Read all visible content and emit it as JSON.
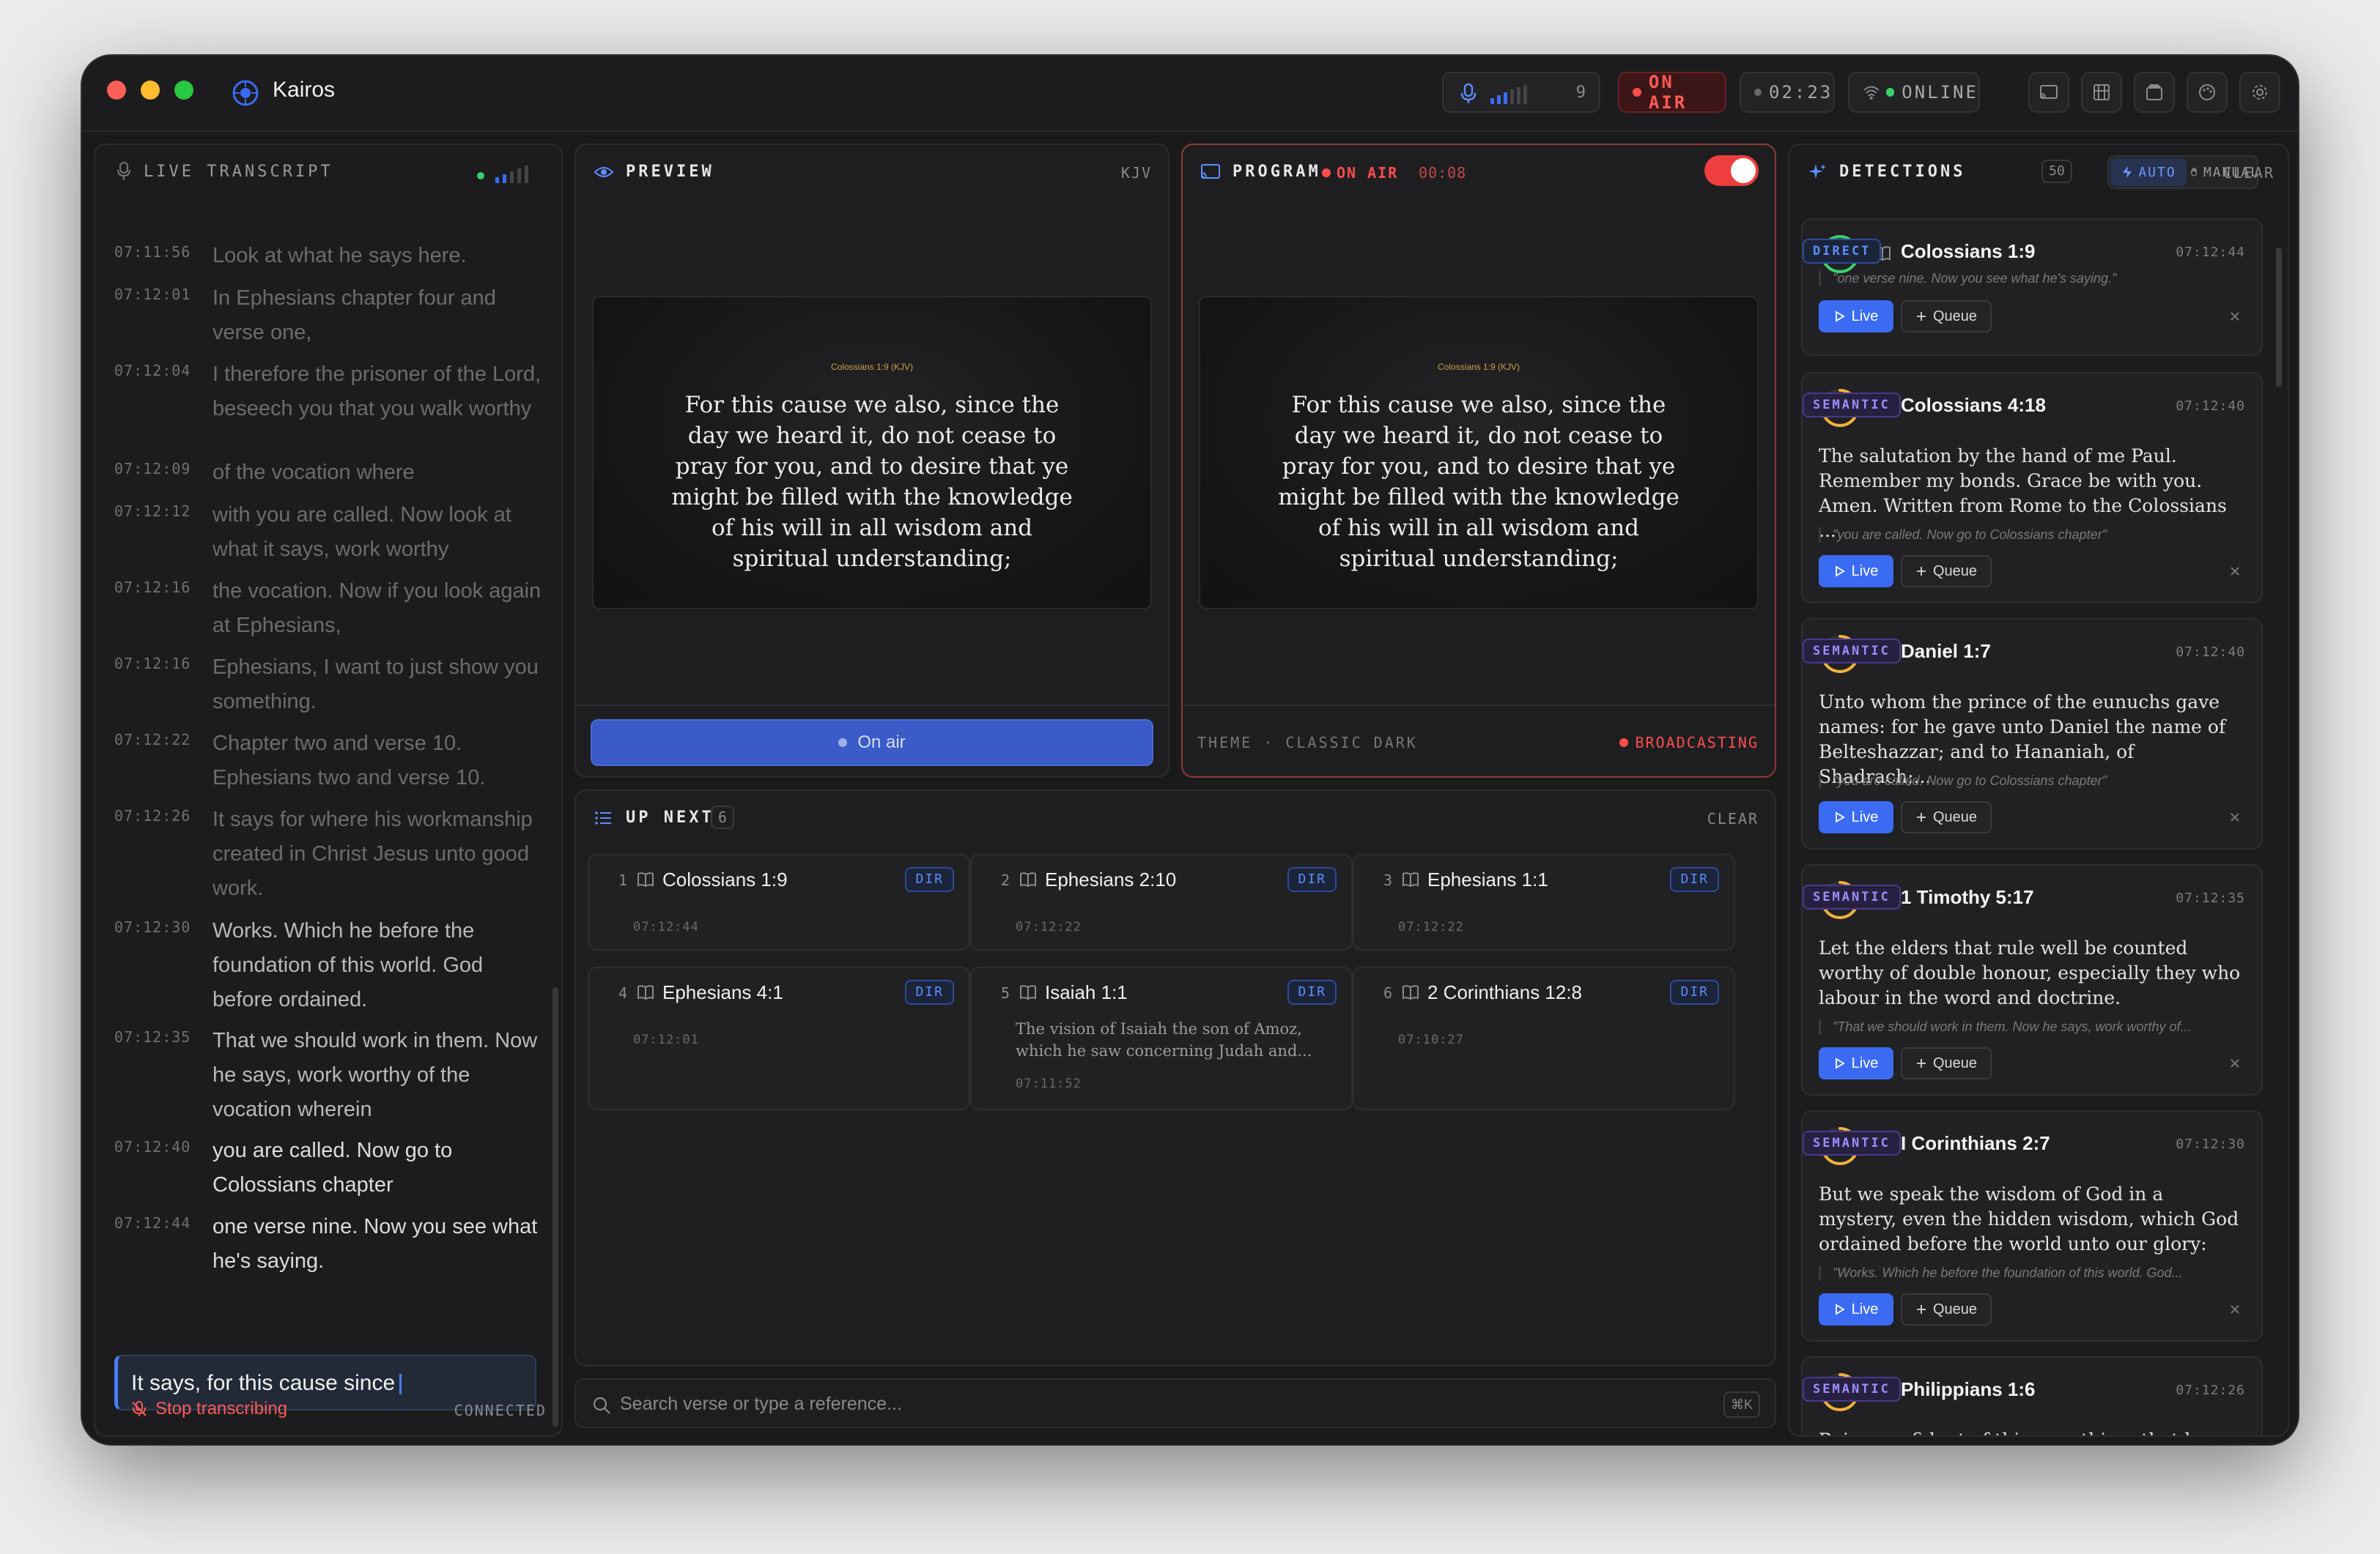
{
  "app": {
    "title": "Kairos",
    "mic_level": "9",
    "on_air_label": "ON AIR",
    "elapsed": "02:23",
    "connection": "ONLINE"
  },
  "colors": {
    "accent": "#3b6bf3",
    "on_air": "#ff4d4d",
    "direct": "#5d8dff",
    "semantic": "#a08cff",
    "online": "#3ad168"
  },
  "transcript": {
    "title": "LIVE TRANSCRIPT",
    "lines": [
      {
        "time": "07:11:56",
        "text": "Look at what he says here."
      },
      {
        "time": "07:12:01",
        "text": "In Ephesians chapter four and verse one,"
      },
      {
        "time": "07:12:04",
        "text": "I therefore the prisoner of the Lord, beseech you that you walk worthy"
      },
      {
        "time": "07:12:09",
        "text": "of the vocation where"
      },
      {
        "time": "07:12:12",
        "text": "with you are called. Now look at what it says, work worthy"
      },
      {
        "time": "07:12:16",
        "text": "the vocation. Now if you look again at Ephesians,"
      },
      {
        "time": "07:12:16",
        "text": "Ephesians, I want to just show you something."
      },
      {
        "time": "07:12:22",
        "text": "Chapter two and verse 10. Ephesians two and verse 10."
      },
      {
        "time": "07:12:26",
        "text": "It says for where his workmanship created in Christ Jesus unto good work."
      },
      {
        "time": "07:12:30",
        "text": "Works. Which he before the foundation of this world. God before ordained."
      },
      {
        "time": "07:12:35",
        "text": "That we should work in them. Now he says, work worthy of the vocation wherein"
      },
      {
        "time": "07:12:40",
        "text": "you are called. Now go to Colossians chapter"
      },
      {
        "time": "07:12:44",
        "text": "one verse nine. Now you see what he's saying."
      }
    ],
    "live_text": "It says, for this cause since",
    "stop_label": "Stop transcribing",
    "status": "CONNECTED"
  },
  "preview": {
    "title": "PREVIEW",
    "version": "KJV",
    "slide_ref": "Colossians 1:9 (KJV)",
    "slide_text": "For this cause we also, since the day we heard it, do not cease to pray for you, and to desire that ye might be filled with the knowledge of his will in all wisdom and spiritual understanding;",
    "button_label": "On air"
  },
  "program": {
    "title": "PROGRAM",
    "on_air": "ON AIR",
    "timer": "00:08",
    "slide_ref": "Colossians 1:9 (KJV)",
    "slide_text": "For this cause we also, since the day we heard it, do not cease to pray for you, and to desire that ye might be filled with the knowledge of his will in all wisdom and spiritual understanding;",
    "theme": "THEME · CLASSIC DARK",
    "status": "BROADCASTING"
  },
  "up_next": {
    "title": "UP NEXT",
    "count": "6",
    "clear": "CLEAR",
    "items": [
      {
        "n": "1",
        "ref": "Colossians 1:9",
        "badge": "DIR",
        "time": "07:12:44",
        "snippet": ""
      },
      {
        "n": "2",
        "ref": "Ephesians 2:10",
        "badge": "DIR",
        "time": "07:12:22",
        "snippet": ""
      },
      {
        "n": "3",
        "ref": "Ephesians 1:1",
        "badge": "DIR",
        "time": "07:12:22",
        "snippet": ""
      },
      {
        "n": "4",
        "ref": "Ephesians 4:1",
        "badge": "DIR",
        "time": "07:12:01",
        "snippet": ""
      },
      {
        "n": "5",
        "ref": "Isaiah 1:1",
        "badge": "DIR",
        "time": "07:11:52",
        "snippet": "The vision of Isaiah the son of Amoz, which he saw concerning Judah and..."
      },
      {
        "n": "6",
        "ref": "2 Corinthians 12:8",
        "badge": "DIR",
        "time": "07:10:27",
        "snippet": ""
      }
    ]
  },
  "search": {
    "placeholder": "Search verse or type a reference...",
    "shortcut": "⌘K"
  },
  "detections": {
    "title": "DETECTIONS",
    "count": "50",
    "mode_auto": "AUTO",
    "mode_manual": "MANUAL",
    "clear": "CLEAR",
    "live_label": "Live",
    "queue_label": "Queue",
    "items": [
      {
        "score": "100",
        "score_pct": 100,
        "ref": "Colossians 1:9",
        "tag": "DIRECT",
        "time": "07:12:44",
        "verse": "",
        "quote": "\"one verse nine. Now you see what he's saying.\""
      },
      {
        "score": "75",
        "score_pct": 75,
        "ref": "Colossians 4:18",
        "tag": "SEMANTIC",
        "time": "07:12:40",
        "verse": "The salutation by the hand of me Paul. Remember my bonds. Grace be with you. Amen. Written from Rome to the Colossians ...",
        "quote": "\"you are called. Now go to Colossians chapter\""
      },
      {
        "score": "71",
        "score_pct": 71,
        "ref": "Daniel 1:7",
        "tag": "SEMANTIC",
        "time": "07:12:40",
        "verse": "Unto whom the prince of the eunuchs gave names: for he gave unto Daniel the name of Belteshazzar; and to Hananiah, of Shadrach;...",
        "quote": "\"you are called. Now go to Colossians chapter\""
      },
      {
        "score": "71",
        "score_pct": 71,
        "ref": "1 Timothy 5:17",
        "tag": "SEMANTIC",
        "time": "07:12:35",
        "verse": "Let the elders that rule well be counted worthy of double honour, especially they who labour in the word and doctrine.",
        "quote": "\"That we should work in them. Now he says, work worthy of..."
      },
      {
        "score": "75",
        "score_pct": 75,
        "ref": "I Corinthians 2:7",
        "tag": "SEMANTIC",
        "time": "07:12:30",
        "verse": "But we speak the wisdom of God in a mystery, even the hidden wisdom, which God ordained before the world unto our glory:",
        "quote": "\"Works. Which he before the foundation of this world. God..."
      },
      {
        "score": "71",
        "score_pct": 71,
        "ref": "Philippians 1:6",
        "tag": "SEMANTIC",
        "time": "07:12:26",
        "verse": "Being confident of this very thing, that he",
        "quote": ""
      }
    ]
  }
}
